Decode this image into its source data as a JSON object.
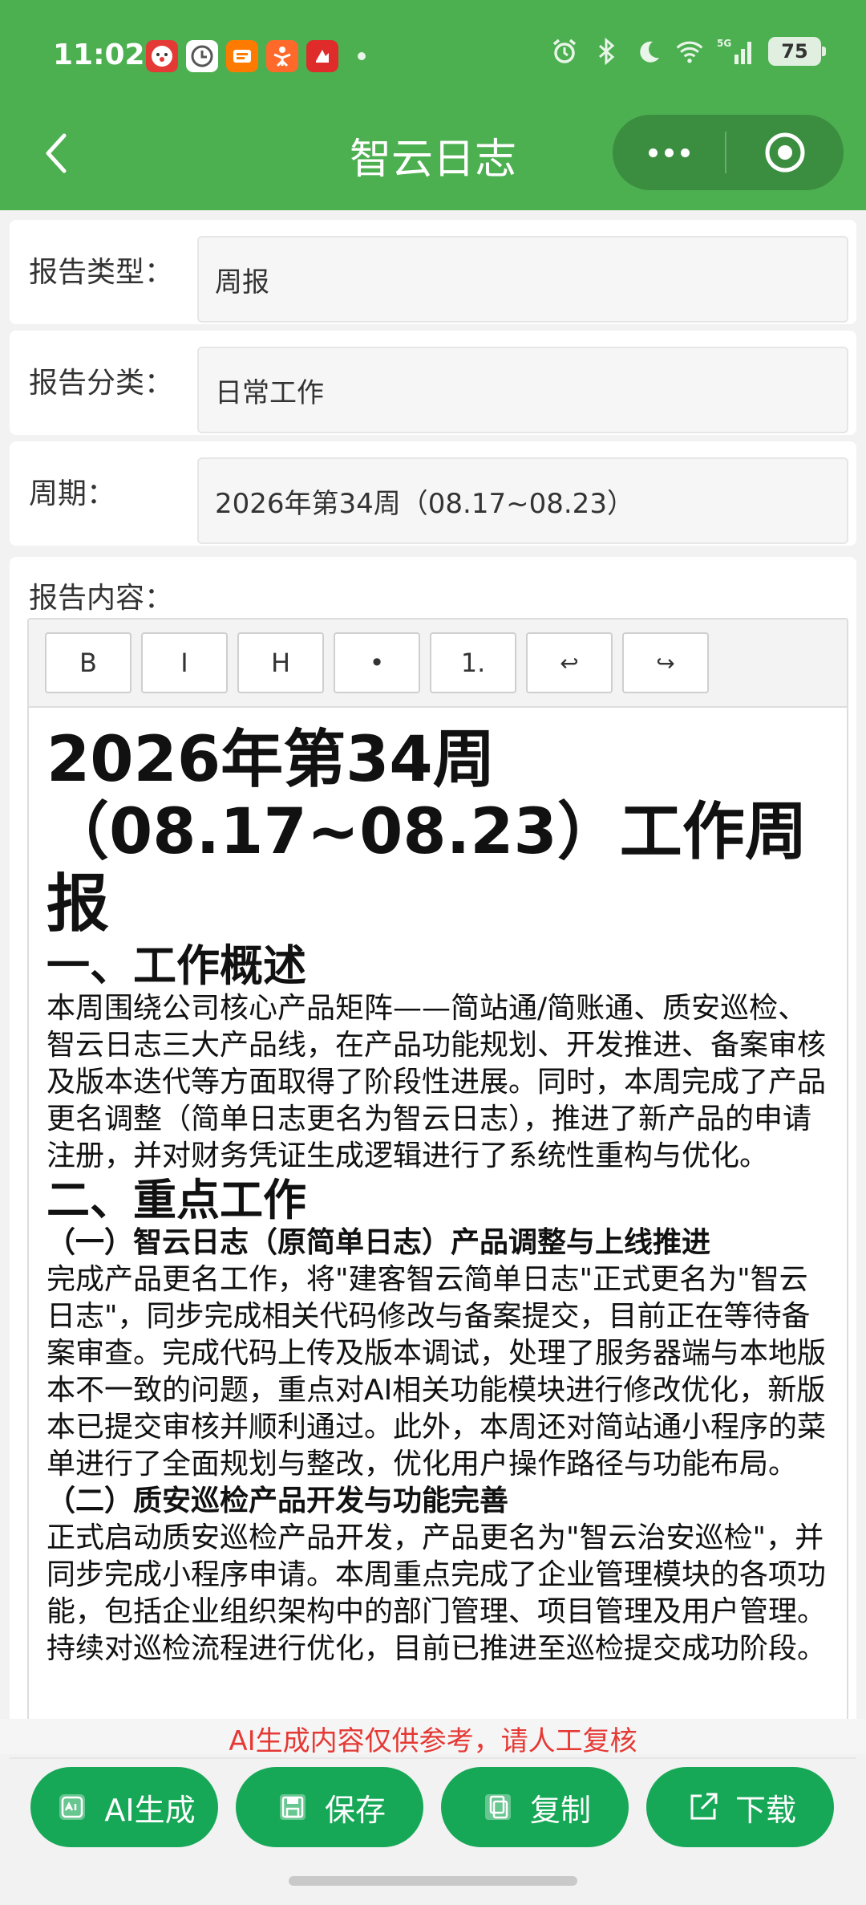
{
  "status_bar": {
    "time": "11:02",
    "battery": "75",
    "network": "5G"
  },
  "header": {
    "title": "智云日志"
  },
  "fields": [
    {
      "label": "报告类型：",
      "value": "周报"
    },
    {
      "label": "报告分类：",
      "value": "日常工作"
    },
    {
      "label": "周期：",
      "value": "2026年第34周（08.17~08.23）"
    }
  ],
  "content": {
    "label": "报告内容：",
    "toolbar": [
      "B",
      "I",
      "H",
      "•",
      "1.",
      "↩",
      "↪"
    ],
    "title_line1": "2026年第34周",
    "title_line2": "（08.17~08.23）工作周报",
    "section1_heading": "一、工作概述",
    "section1_p": "本周围绕公司核心产品矩阵——简站通/简账通、质安巡检、智云日志三大产品线，在产品功能规划、开发推进、备案审核及版本迭代等方面取得了阶段性进展。同时，本周完成了产品更名调整（简单日志更名为智云日志），推进了新产品的申请注册，并对财务凭证生成逻辑进行了系统性重构与优化。",
    "section2_heading": "二、重点工作",
    "sub1_heading": "（一）智云日志（原简单日志）产品调整与上线推进",
    "sub1_p": "完成产品更名工作，将\"建客智云简单日志\"正式更名为\"智云日志\"，同步完成相关代码修改与备案提交，目前正在等待备案审查。完成代码上传及版本调试，处理了服务器端与本地版本不一致的问题，重点对AI相关功能模块进行修改优化，新版本已提交审核并顺利通过。此外，本周还对简站通小程序的菜单进行了全面规划与整改，优化用户操作路径与功能布局。",
    "sub2_heading": "（二）质安巡检产品开发与功能完善",
    "sub2_p": "正式启动质安巡检产品开发，产品更名为\"智云治安巡检\"，并同步完成小程序申请。本周重点完成了企业管理模块的各项功能，包括企业组织架构中的部门管理、项目管理及用户管理。持续对巡检流程进行优化，目前已推进至巡检提交成功阶段。"
  },
  "notice": "AI生成内容仅供参考，请人工复核",
  "actions": [
    {
      "label": "AI生成",
      "icon": "ai-chip-icon"
    },
    {
      "label": "保存",
      "icon": "floppy-icon"
    },
    {
      "label": "复制",
      "icon": "copy-icon"
    },
    {
      "label": "下载",
      "icon": "external-link-icon"
    }
  ],
  "colors": {
    "header_green": "#4caf50",
    "button_green": "#17a857",
    "notice_red": "#e53935"
  }
}
